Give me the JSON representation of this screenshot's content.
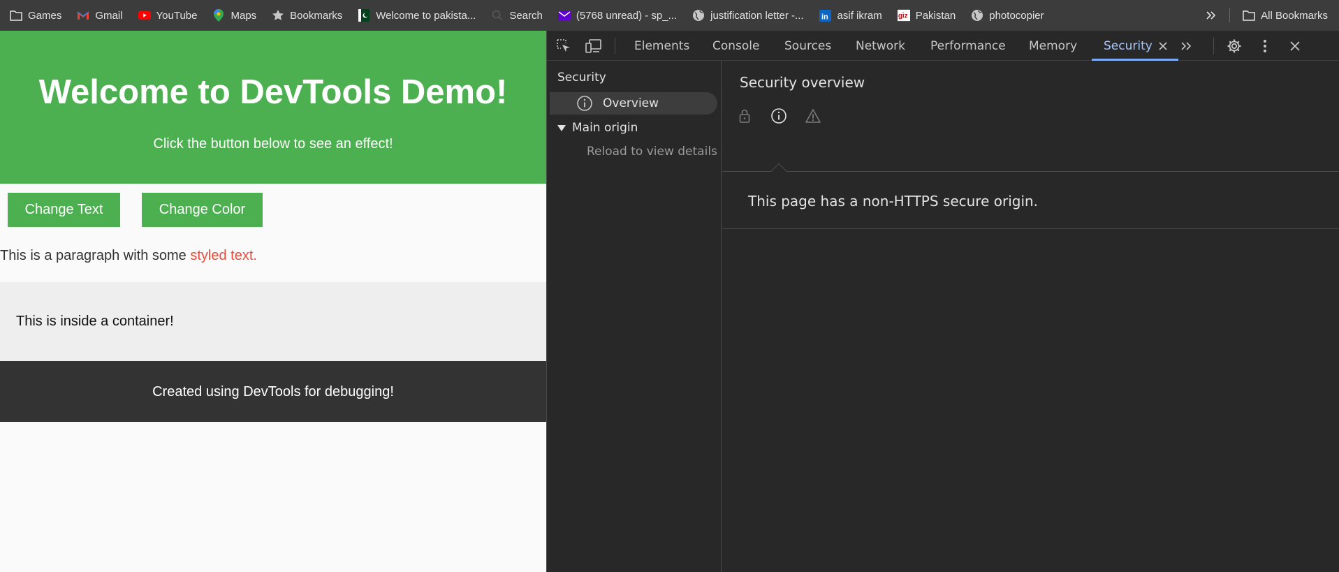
{
  "bookmarks": {
    "items": [
      {
        "label": "Games",
        "icon": "folder-icon"
      },
      {
        "label": "Gmail",
        "icon": "gmail-icon"
      },
      {
        "label": "YouTube",
        "icon": "youtube-icon"
      },
      {
        "label": "Maps",
        "icon": "maps-icon"
      },
      {
        "label": "Bookmarks",
        "icon": "star-icon"
      },
      {
        "label": "Welcome to pakista...",
        "icon": "pakistan-flag-icon"
      },
      {
        "label": "Search",
        "icon": "search-icon"
      },
      {
        "label": "(5768 unread) - sp_...",
        "icon": "yahoo-mail-icon"
      },
      {
        "label": "justification letter -...",
        "icon": "globe-icon"
      },
      {
        "label": "asif ikram",
        "icon": "linkedin-icon"
      },
      {
        "label": "Pakistan",
        "icon": "giz-icon"
      },
      {
        "label": "photocopier",
        "icon": "globe-icon"
      }
    ],
    "all_bookmarks": "All Bookmarks"
  },
  "page": {
    "heading": "Welcome to DevTools Demo!",
    "subheading": "Click the button below to see an effect!",
    "buttons": {
      "change_text": "Change Text",
      "change_color": "Change Color"
    },
    "paragraph": {
      "text": "This is a paragraph with some ",
      "styled": "styled text."
    },
    "container_text": "This is inside a container!",
    "footer_text": "Created using DevTools for debugging!"
  },
  "devtools": {
    "tabs": [
      "Elements",
      "Console",
      "Sources",
      "Network",
      "Performance",
      "Memory",
      "Security"
    ],
    "active_tab": "Security",
    "sidebar": {
      "title": "Security",
      "overview": "Overview",
      "main_origin": "Main origin",
      "reload": "Reload to view details"
    },
    "main": {
      "title": "Security overview",
      "message": "This page has a non-HTTPS secure origin."
    }
  },
  "colors": {
    "brand_green": "#4caf50",
    "styled_text": "#e74c3c",
    "footer_bg": "#333333",
    "devtools_bg": "#282828",
    "active_tab": "#a8c7fa"
  }
}
